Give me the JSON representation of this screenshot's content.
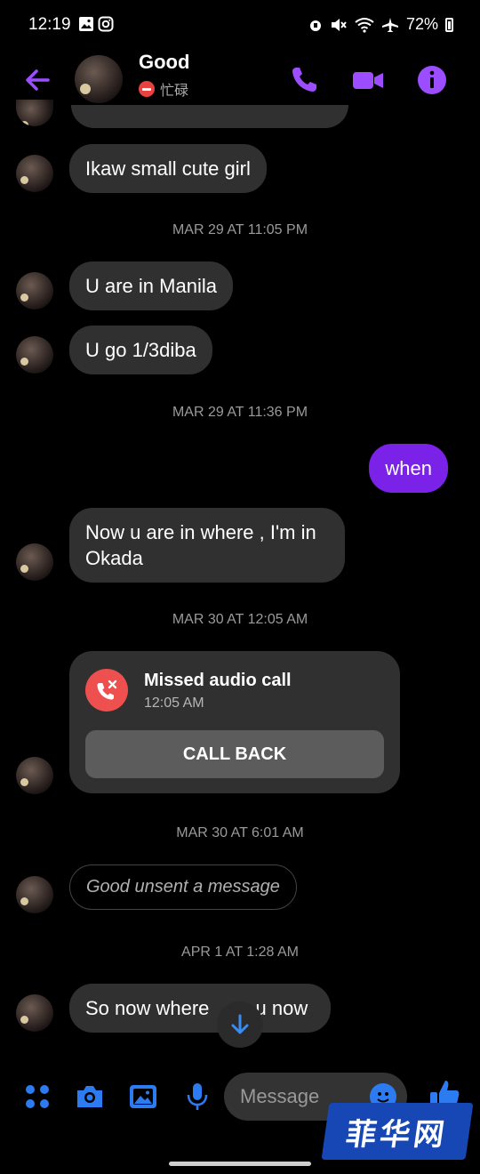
{
  "status_bar": {
    "time": "12:19",
    "battery": "72%"
  },
  "header": {
    "name": "Good",
    "status": "忙碌"
  },
  "messages": {
    "m1": "Ikaw small cute girl",
    "ts1": "MAR 29 AT 11:05 PM",
    "m2": "U are in Manila",
    "m3": "U go 1/3diba",
    "ts2": "MAR 29 AT 11:36 PM",
    "m4_out": "when",
    "m5": "Now u are in where , I'm in Okada",
    "ts3": "MAR 30 AT 12:05 AM",
    "call": {
      "title": "Missed audio call",
      "time": "12:05 AM",
      "button": "CALL BACK"
    },
    "ts4": "MAR 30 AT 6:01 AM",
    "unsent": "Good unsent a message",
    "ts5": "APR 1 AT 1:28 AM",
    "m6": "So now where ",
    "m6b": "u now"
  },
  "composer": {
    "placeholder": "Message"
  },
  "watermark": "菲华网",
  "colors": {
    "accent": "#9b4dff",
    "outgoing": "#7b22e8",
    "missed": "#ee4f4f",
    "blue": "#2d7bf0"
  }
}
